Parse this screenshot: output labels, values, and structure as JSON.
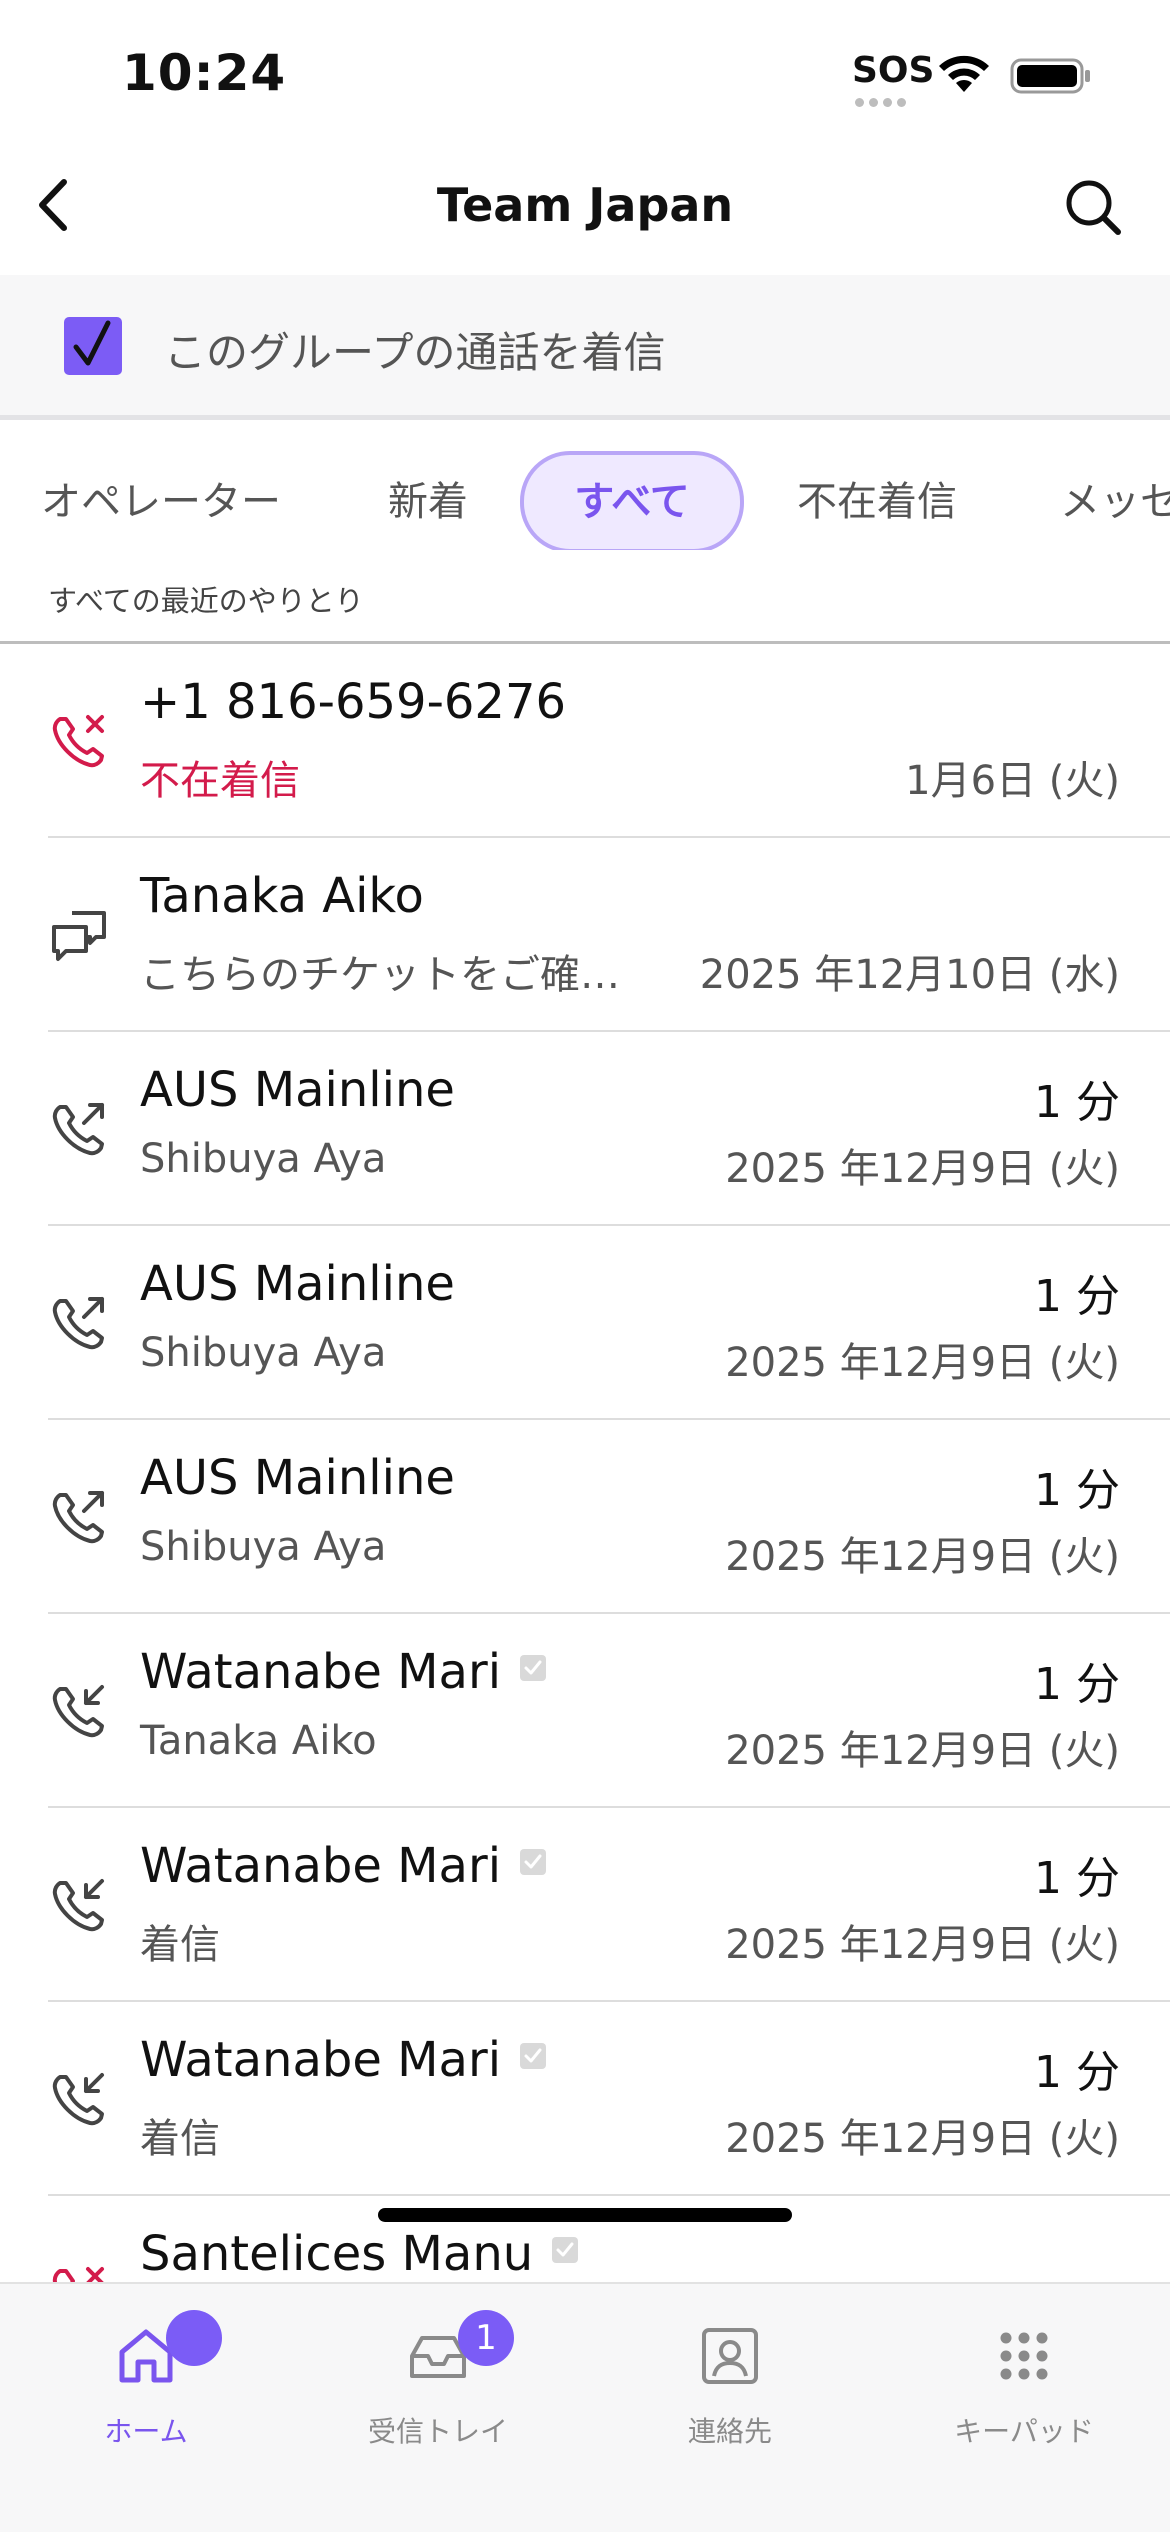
{
  "status_bar": {
    "time": "10:24",
    "sos": "SOS"
  },
  "nav": {
    "title": "Team Japan"
  },
  "group_banner": {
    "checked": true,
    "label": "このグループの通話を着信"
  },
  "tabs": [
    {
      "label": "オペレーター",
      "active": false
    },
    {
      "label": "新着",
      "active": false
    },
    {
      "label": "すべて",
      "active": true
    },
    {
      "label": "不在着信",
      "active": false
    },
    {
      "label": "メッセ",
      "active": false
    }
  ],
  "section": {
    "caption": "すべての最近のやりとり"
  },
  "rows": [
    {
      "kind": "missed",
      "icon": "missed-call-icon",
      "title": "+1 816-659-6276",
      "subtitle": "不在着信",
      "duration": "",
      "date": "1月6日 (火)",
      "verified": false
    },
    {
      "kind": "message",
      "icon": "message-icon",
      "title": "Tanaka Aiko",
      "subtitle": "こちらのチケットをご確…",
      "duration": "",
      "date": "2025 年12月10日 (水)",
      "verified": false
    },
    {
      "kind": "outgoing",
      "icon": "outgoing-call-icon",
      "title": "AUS Mainline",
      "subtitle": "Shibuya Aya",
      "duration": "1 分",
      "date": "2025 年12月9日 (火)",
      "verified": false
    },
    {
      "kind": "outgoing",
      "icon": "outgoing-call-icon",
      "title": "AUS Mainline",
      "subtitle": "Shibuya Aya",
      "duration": "1 分",
      "date": "2025 年12月9日 (火)",
      "verified": false
    },
    {
      "kind": "outgoing",
      "icon": "outgoing-call-icon",
      "title": "AUS Mainline",
      "subtitle": "Shibuya Aya",
      "duration": "1 分",
      "date": "2025 年12月9日 (火)",
      "verified": false
    },
    {
      "kind": "incoming",
      "icon": "incoming-call-icon",
      "title": "Watanabe Mari",
      "subtitle": "Tanaka Aiko",
      "duration": "1 分",
      "date": "2025 年12月9日 (火)",
      "verified": true
    },
    {
      "kind": "incoming",
      "icon": "incoming-call-icon",
      "title": "Watanabe Mari",
      "subtitle": "着信",
      "duration": "1 分",
      "date": "2025 年12月9日 (火)",
      "verified": true
    },
    {
      "kind": "incoming",
      "icon": "incoming-call-icon",
      "title": "Watanabe Mari",
      "subtitle": "着信",
      "duration": "1 分",
      "date": "2025 年12月9日 (火)",
      "verified": true
    },
    {
      "kind": "missed",
      "icon": "missed-call-icon",
      "title": "Santelices Manu",
      "subtitle": "",
      "duration": "",
      "date": "",
      "verified": true
    }
  ],
  "tab_bar": {
    "items": [
      {
        "label": "ホーム",
        "icon": "home-icon",
        "active": true,
        "badge": ""
      },
      {
        "label": "受信トレイ",
        "icon": "inbox-icon",
        "active": false,
        "badge": "1"
      },
      {
        "label": "連絡先",
        "icon": "contacts-icon",
        "active": false,
        "badge": ""
      },
      {
        "label": "キーパッド",
        "icon": "keypad-icon",
        "active": false,
        "badge": ""
      }
    ]
  },
  "colors": {
    "accent": "#7a55ee",
    "missed": "#d31b4b",
    "badge": "#7b5cf6"
  }
}
